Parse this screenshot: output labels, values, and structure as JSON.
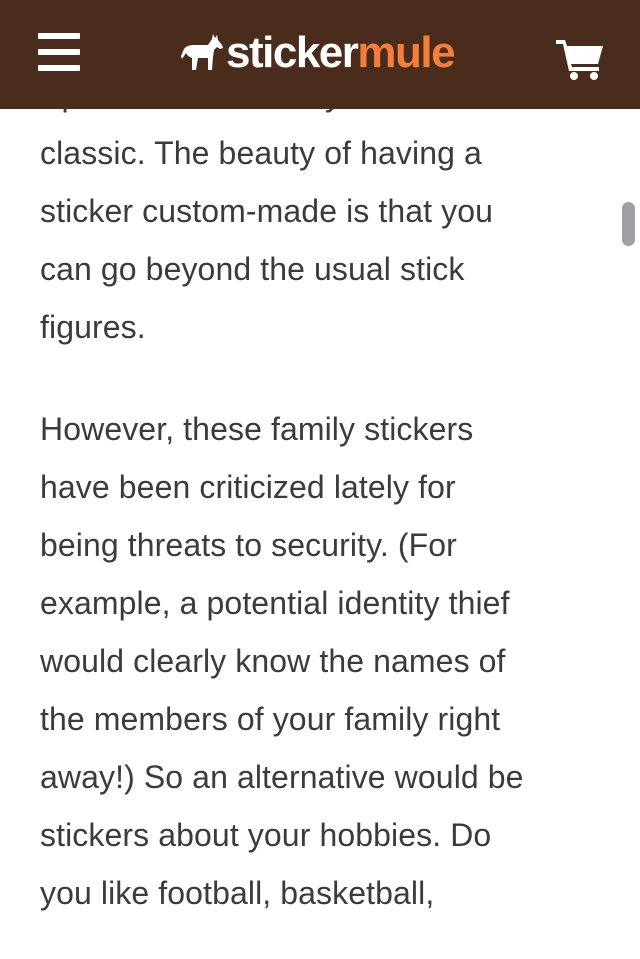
{
  "colors": {
    "brand_brown": "#4a2c1d",
    "brand_orange": "#f47f3c",
    "text": "#3b3b3b",
    "background": "#ffffff"
  },
  "header": {
    "menu_icon": "hamburger-menu-icon",
    "logo": {
      "icon": "mule-icon",
      "text_part1": "sticker",
      "text_part2": "mule"
    },
    "cart_icon": "shopping-cart-icon"
  },
  "article": {
    "paragraphs": [
      {
        "lines": [
          "Spot. You can’t really fault a",
          "classic. The beauty of having a",
          "sticker custom-made is that you",
          "can go beyond the usual stick",
          "figures."
        ]
      },
      {
        "lines": [
          "However, these family stickers",
          "have been criticized lately for",
          "being threats to security. (For",
          "example, a potential identity thief",
          "would clearly know the names of",
          "the members of your family right",
          "away!) So an alternative would be",
          "stickers about your hobbies. Do",
          "you like football, basketball,"
        ]
      }
    ]
  }
}
